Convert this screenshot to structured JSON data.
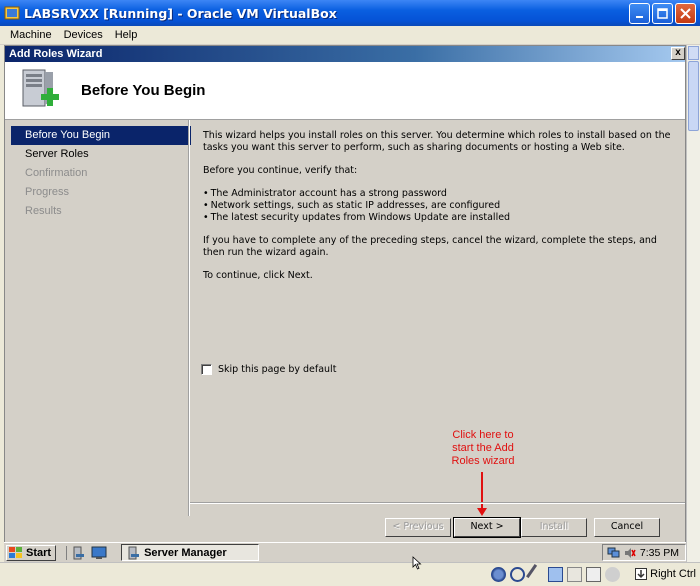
{
  "window": {
    "title": "LABSRVXX [Running] - Oracle VM VirtualBox"
  },
  "menu": [
    "Machine",
    "Devices",
    "Help"
  ],
  "wizard": {
    "title": "Add Roles Wizard",
    "close_label": "x",
    "heading": "Before You Begin",
    "steps": [
      {
        "label": "Before You Begin",
        "state": "active"
      },
      {
        "label": "Server Roles",
        "state": "enabled"
      },
      {
        "label": "Confirmation",
        "state": "disabled"
      },
      {
        "label": "Progress",
        "state": "disabled"
      },
      {
        "label": "Results",
        "state": "disabled"
      }
    ],
    "intro": "This wizard helps you install roles on this server. You determine which roles to install based on the tasks you want this server to perform, such as sharing documents or hosting a Web site.",
    "verify_heading": "Before you continue, verify that:",
    "checklist": [
      "The Administrator account has a strong password",
      "Network settings, such as static IP addresses, are configured",
      "The latest security updates from Windows Update are installed"
    ],
    "preceding_steps": "If you have to complete any of the preceding steps, cancel the wizard, complete the steps, and then run the wizard again.",
    "continue_text": "To continue, click Next.",
    "skip_label": "Skip this page by default",
    "buttons": {
      "previous": "< Previous",
      "next": "Next >",
      "install": "Install",
      "cancel": "Cancel"
    }
  },
  "annotation": {
    "text": "Click here to start the Add Roles wizard",
    "color": "#e01010"
  },
  "taskbar": {
    "start_label": "Start",
    "task_label": "Server Manager",
    "clock": "7:35 PM"
  },
  "vbox_status": {
    "host_key": "Right Ctrl"
  },
  "colors": {
    "xp_title": "#0552d6",
    "wizard_title": "#0a246a",
    "selection": "#0a246a"
  }
}
